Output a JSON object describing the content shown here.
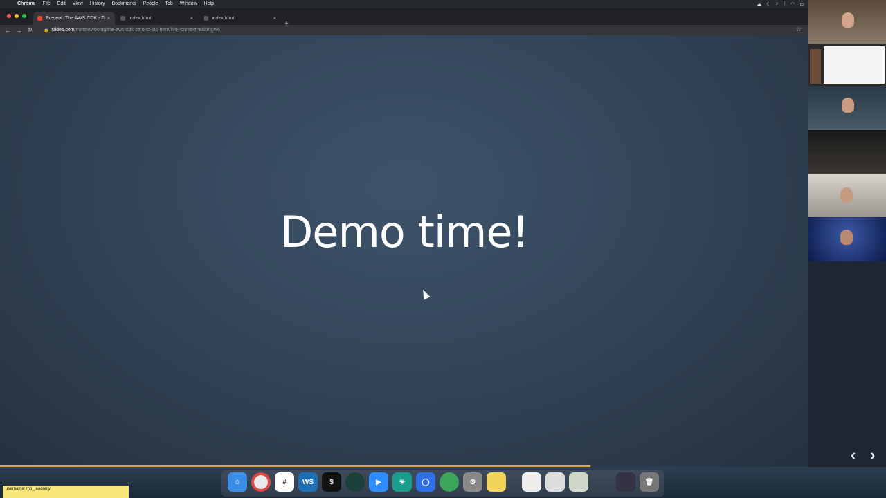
{
  "menubar": {
    "app": "Chrome",
    "items": [
      "File",
      "Edit",
      "View",
      "History",
      "Bookmarks",
      "People",
      "Tab",
      "Window",
      "Help"
    ]
  },
  "tabs": [
    {
      "title": "Present: The AWS CDK - Zero",
      "active": true
    },
    {
      "title": "index.html",
      "active": false
    },
    {
      "title": "index.html",
      "active": false
    }
  ],
  "address": {
    "host": "slides.com",
    "path": "/matthewbonig/the-aws-cdk-zero-to-iac-hero/live?context=editing#/6"
  },
  "slide": {
    "title": "Demo time!",
    "progress_fraction": 0.73
  },
  "sticky_note": {
    "text": "username: mb_readonly"
  },
  "colors": {
    "slide_bg": "#334559",
    "progress": "#e3a33a",
    "sticky": "#f7e77a"
  }
}
